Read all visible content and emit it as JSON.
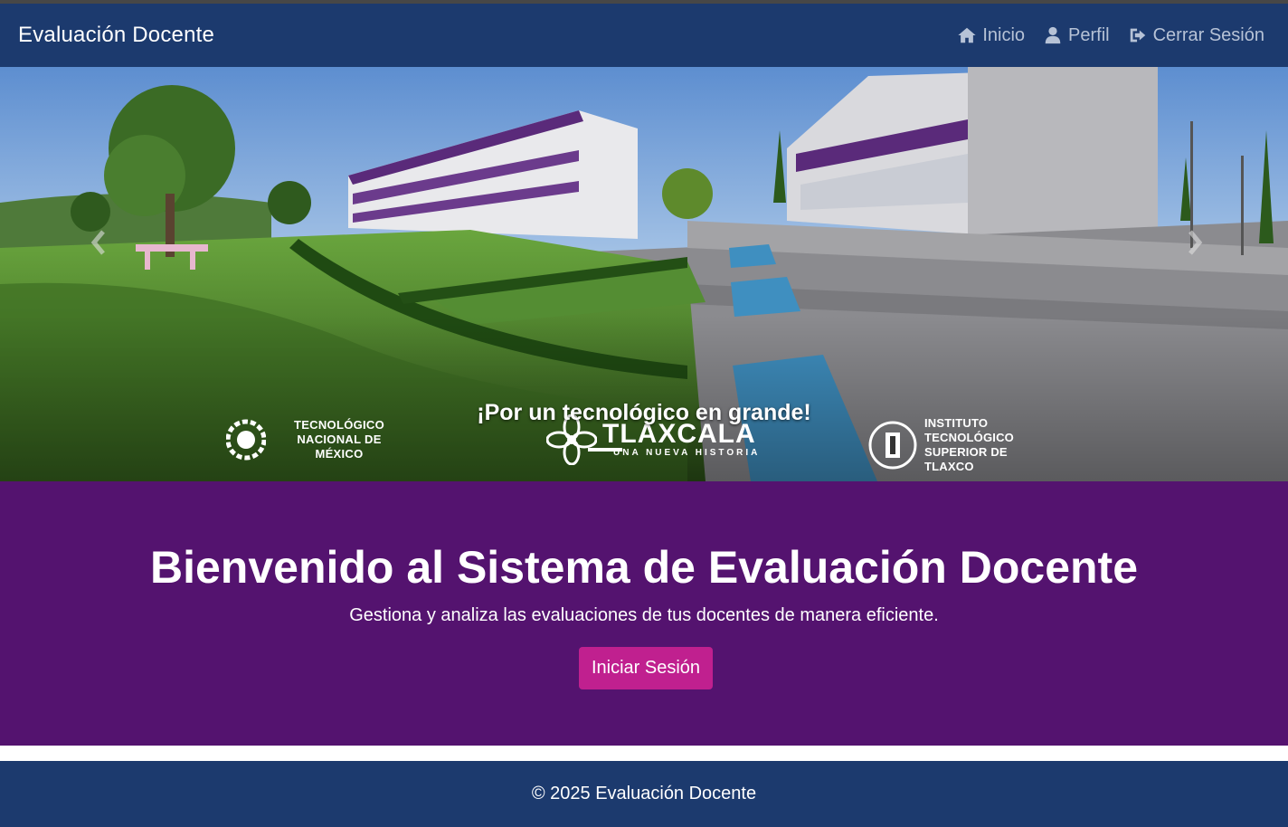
{
  "navbar": {
    "brand": "Evaluación Docente",
    "links": [
      {
        "label": "Inicio",
        "icon": "home-icon"
      },
      {
        "label": "Perfil",
        "icon": "user-icon"
      },
      {
        "label": "Cerrar Sesión",
        "icon": "sign-out-icon"
      }
    ]
  },
  "carousel": {
    "caption": "¡Por un tecnológico en grande!",
    "logos": {
      "tecnm": "TECNOLÓGICO NACIONAL DE MÉXICO",
      "tlaxcala": "TLAXCALA",
      "tlaxcala_tagline": "UNA NUEVA HISTORIA",
      "its": "INSTITUTO TECNOLÓGICO SUPERIOR DE TLAXCO"
    },
    "prev_icon": "chevron-left-icon",
    "next_icon": "chevron-right-icon"
  },
  "hero": {
    "title": "Bienvenido al Sistema de Evaluación Docente",
    "subtitle": "Gestiona y analiza las evaluaciones de tus docentes de manera eficiente.",
    "button": "Iniciar Sesión"
  },
  "footer": {
    "text": "© 2025 Evaluación Docente"
  },
  "colors": {
    "navbar": "#1c3a6e",
    "hero": "#54136f",
    "button": "#c0208f"
  }
}
